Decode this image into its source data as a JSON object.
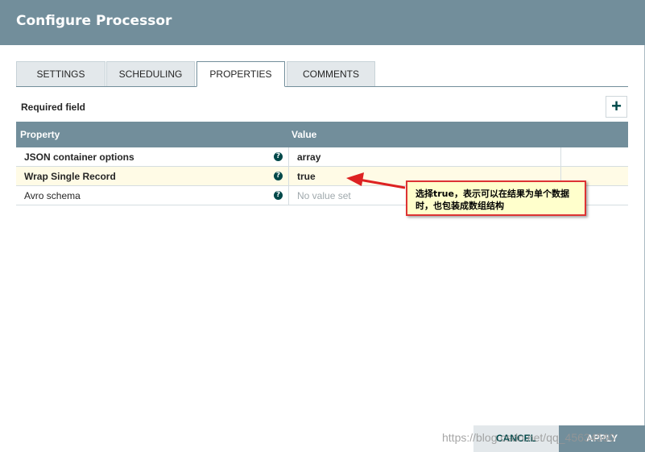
{
  "dialog": {
    "title": "Configure Processor"
  },
  "tabs": [
    {
      "label": "SETTINGS",
      "active": false
    },
    {
      "label": "SCHEDULING",
      "active": false
    },
    {
      "label": "PROPERTIES",
      "active": true
    },
    {
      "label": "COMMENTS",
      "active": false
    }
  ],
  "properties_panel": {
    "required_label": "Required field",
    "add_icon": "+",
    "columns": {
      "property": "Property",
      "value": "Value"
    },
    "rows": [
      {
        "name": "JSON container options",
        "value": "array",
        "required": true,
        "selected": false
      },
      {
        "name": "Wrap Single Record",
        "value": "true",
        "required": true,
        "selected": true
      },
      {
        "name": "Avro schema",
        "value": "No value set",
        "required": false,
        "selected": false
      }
    ],
    "help_icon": "?"
  },
  "annotation": {
    "text": "选择true，表示可以在结果为单个数据时，也包装成数组结构"
  },
  "footer": {
    "cancel_label": "CANCEL",
    "apply_label": "APPLY"
  },
  "watermark": "https://blog.csdn.net/qq_45634560",
  "colors": {
    "header": "#728e9b",
    "accent": "#004849",
    "selected_row": "#fffbe6",
    "annotation_border": "#dd3333"
  }
}
